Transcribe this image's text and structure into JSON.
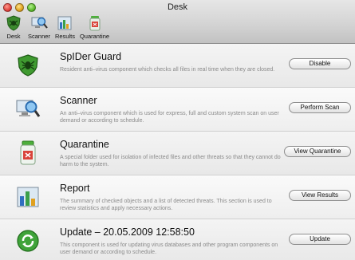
{
  "window": {
    "title": "Desk"
  },
  "toolbar": {
    "items": [
      {
        "label": "Desk",
        "icon": "spider-shield-icon"
      },
      {
        "label": "Scanner",
        "icon": "scanner-magnifier-icon"
      },
      {
        "label": "Results",
        "icon": "results-chart-icon"
      },
      {
        "label": "Quarantine",
        "icon": "quarantine-jar-icon"
      }
    ]
  },
  "rows": [
    {
      "title": "SpIDer Guard",
      "description": "Resident anti–virus component which checks all files in real time when they are closed.",
      "button": "Disable"
    },
    {
      "title": "Scanner",
      "description": "An anti–virus component which is used for express, full and custom system scan on user demand or according to schedule.",
      "button": "Perform Scan"
    },
    {
      "title": "Quarantine",
      "description": "A special folder used for isolation of infected files and other threats so that they cannot do harm to the system.",
      "button": "View Quarantine"
    },
    {
      "title": "Report",
      "description": "The summary of checked objects and a list of detected threats. This section is used to review statistics and apply necessary actions.",
      "button": "View Results"
    },
    {
      "title": "Update – 20.05.2009 12:58:50",
      "description": "This component is used for updating virus databases and other program components on user demand or according to schedule.",
      "button": "Update"
    }
  ]
}
